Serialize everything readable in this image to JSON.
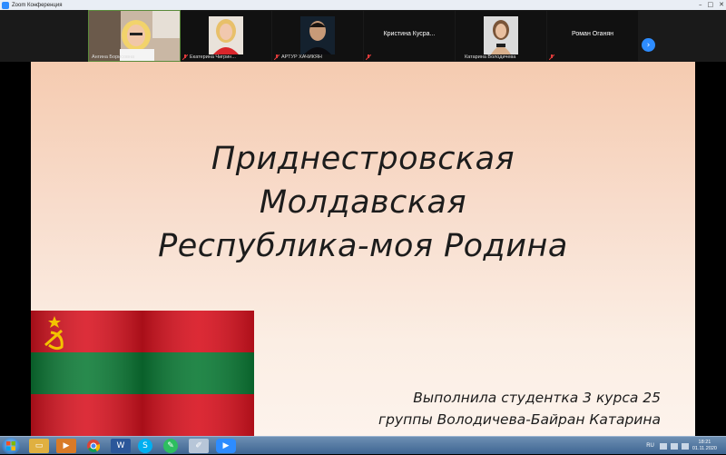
{
  "window": {
    "title": "Zoom Конференция"
  },
  "participants": [
    {
      "name": "Ангина Борисовна",
      "has_video": true,
      "active_speaker": true
    },
    {
      "name": "Екатерина Чигрин...",
      "has_video": true,
      "muted": true
    },
    {
      "name": "АРТУР ХАЧИКЯН",
      "has_video": true,
      "muted": true
    },
    {
      "name": "Кристина  Кусра...",
      "has_video": false,
      "muted": true
    },
    {
      "name": "Катарина Володичева",
      "has_video": true,
      "muted": false
    },
    {
      "name": "Роман Оганян",
      "has_video": false,
      "muted": true
    }
  ],
  "slide": {
    "title_lines": [
      "Приднестровская",
      "Молдавская",
      "Республика-моя Родина"
    ],
    "credit_lines": [
      "Выполнила студентка 3 курса 25",
      "группы Володичева-Байран Катарина"
    ]
  },
  "taskbar": {
    "apps": [
      "explorer",
      "media-player",
      "chrome",
      "word",
      "skype",
      "evernote",
      "paint",
      "zoom"
    ],
    "lang": "RU",
    "time": "18:21",
    "date": "01.11.2020"
  },
  "colors": {
    "flag_red": "#d8121f",
    "flag_green": "#0b7a35",
    "zoom_blue": "#2d8cff"
  }
}
